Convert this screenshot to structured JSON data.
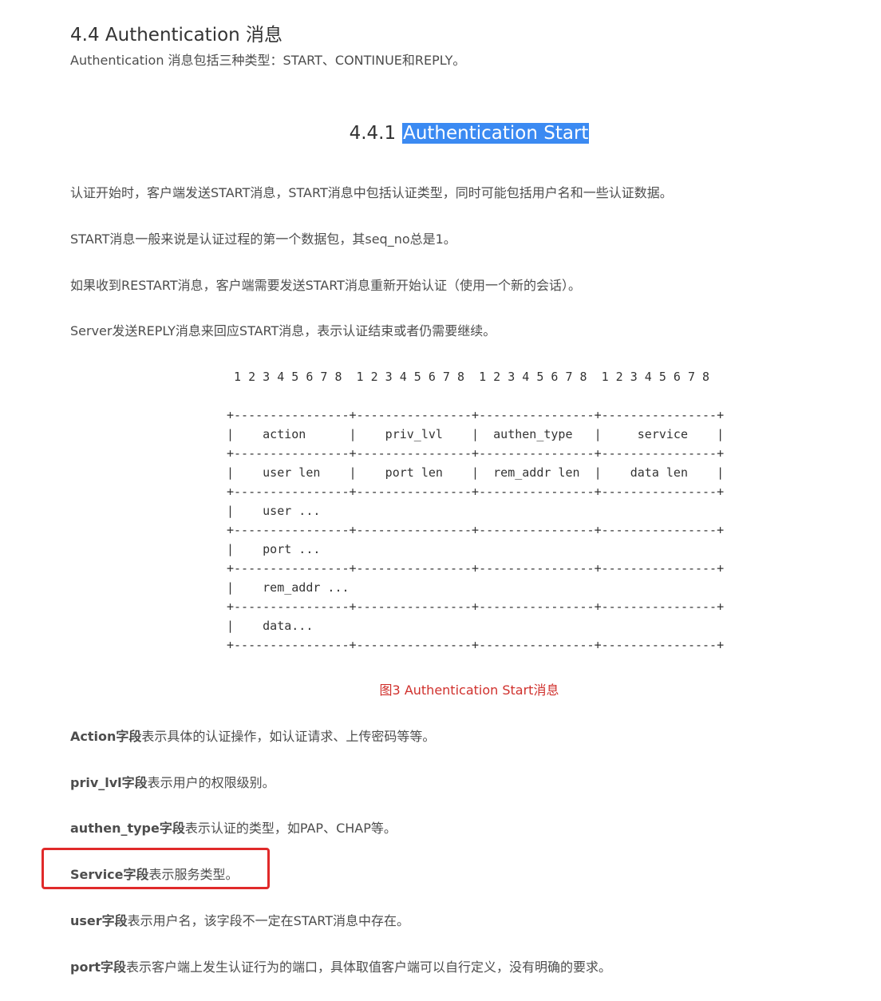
{
  "section": {
    "title": "4.4 Authentication 消息",
    "intro": "Authentication 消息包括三种类型：START、CONTINUE和REPLY。"
  },
  "subsection": {
    "number": "4.4.1",
    "title": "Authentication Start"
  },
  "paragraphs": [
    "认证开始时，客户端发送START消息，START消息中包括认证类型，同时可能包括用户名和一些认证数据。",
    "START消息一般来说是认证过程的第一个数据包，其seq_no总是1。",
    "如果收到RESTART消息，客户端需要发送START消息重新开始认证（使用一个新的会话）。",
    "Server发送REPLY消息来回应START消息，表示认证结束或者仍需要继续。"
  ],
  "diagram": {
    "header": " 1 2 3 4 5 6 7 8  1 2 3 4 5 6 7 8  1 2 3 4 5 6 7 8  1 2 3 4 5 6 7 8",
    "lines": [
      "",
      "+----------------+----------------+----------------+----------------+",
      "|    action      |    priv_lvl    |  authen_type   |     service    |",
      "+----------------+----------------+----------------+----------------+",
      "|    user len    |    port len    |  rem_addr len  |    data len    |",
      "+----------------+----------------+----------------+----------------+",
      "|    user ...",
      "+----------------+----------------+----------------+----------------+",
      "|    port ...",
      "+----------------+----------------+----------------+----------------+",
      "|    rem_addr ...",
      "+----------------+----------------+----------------+----------------+",
      "|    data...",
      "+----------------+----------------+----------------+----------------+"
    ]
  },
  "caption": "图3 Authentication Start消息",
  "fields": [
    {
      "name": "Action字段",
      "desc": "表示具体的认证操作，如认证请求、上传密码等等。"
    },
    {
      "name": "priv_lvl字段",
      "desc": "表示用户的权限级别。"
    },
    {
      "name": "authen_type字段",
      "desc": "表示认证的类型，如PAP、CHAP等。"
    },
    {
      "name": "Service字段",
      "desc": "表示服务类型。"
    },
    {
      "name": "user字段",
      "desc": "表示用户名，该字段不一定在START消息中存在。"
    },
    {
      "name": "port字段",
      "desc": "表示客户端上发生认证行为的端口，具体取值客户端可以自行定义，没有明确的要求。"
    }
  ],
  "colors": {
    "caption": "#d0302c",
    "highlight": "#3b8af2",
    "annotation_box": "#e02a2a"
  }
}
